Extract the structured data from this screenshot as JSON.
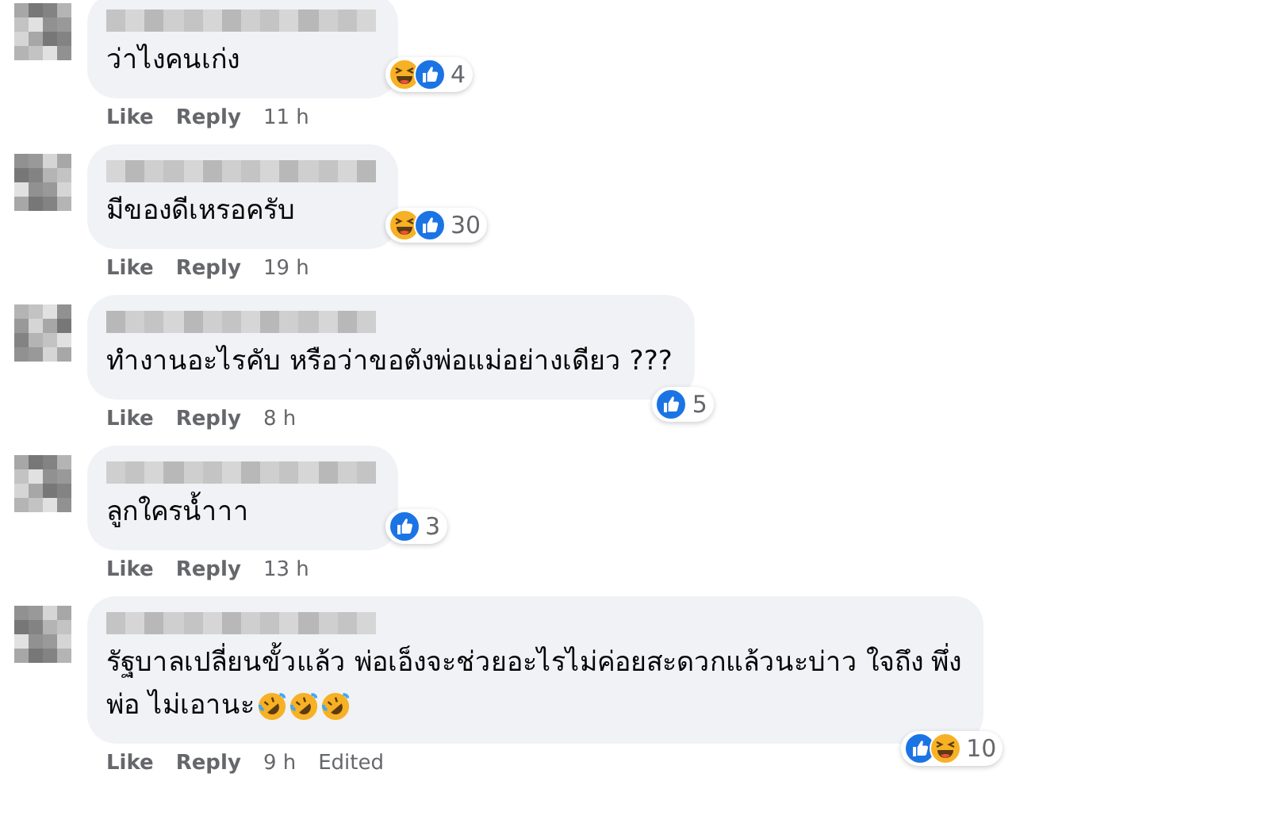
{
  "comments": [
    {
      "lines": [
        "ว่าไงคนเก่ง"
      ],
      "reactions": {
        "icons": [
          {
            "kind": "haha"
          },
          {
            "kind": "like"
          }
        ],
        "count": "4"
      },
      "actions": [
        "Like",
        "Reply"
      ],
      "time": "11 h"
    },
    {
      "lines": [
        "มีของดีเหรอครับ"
      ],
      "reactions": {
        "icons": [
          {
            "kind": "haha"
          },
          {
            "kind": "like"
          }
        ],
        "count": "30"
      },
      "actions": [
        "Like",
        "Reply"
      ],
      "time": "19 h"
    },
    {
      "lines": [
        "ทำงานอะไรคับ หรือว่าขอตังพ่อแม่อย่างเดียว ???"
      ],
      "reactions": {
        "icons": [
          {
            "kind": "like"
          }
        ],
        "count": "5"
      },
      "actions": [
        "Like",
        "Reply"
      ],
      "time": "8 h"
    },
    {
      "lines": [
        "ลูกใครน้ำาา"
      ],
      "reactions": {
        "icons": [
          {
            "kind": "like"
          }
        ],
        "count": "3"
      },
      "actions": [
        "Like",
        "Reply"
      ],
      "time": "13 h"
    },
    {
      "lines": [
        "รัฐบาลเปลี่ยนขั้วแล้ว พ่อเอ็งจะช่วยอะไรไม่ค่อยสะดวกแล้วนะบ่าว ใจถึง พึ่ง",
        "พ่อ ไม่เอานะ"
      ],
      "emoji": [
        {
          "kind": "rofl"
        },
        {
          "kind": "rofl"
        },
        {
          "kind": "rofl"
        }
      ],
      "reactions": {
        "icons": [
          {
            "kind": "like"
          },
          {
            "kind": "haha"
          }
        ],
        "count": "10"
      },
      "actions": [
        "Like",
        "Reply"
      ],
      "time": "9 h",
      "edited": "Edited"
    }
  ]
}
